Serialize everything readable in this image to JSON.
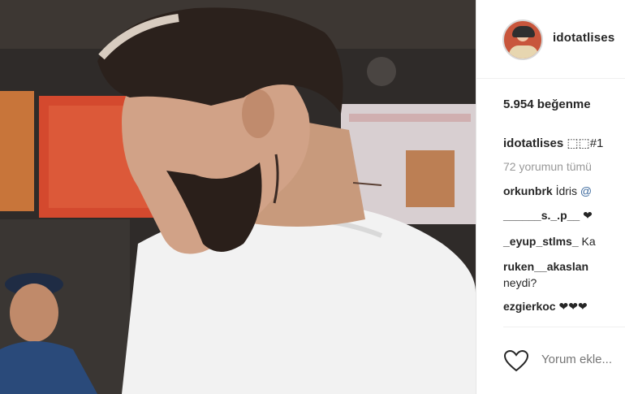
{
  "post": {
    "username": "idotatlises",
    "likes": "5.954 beğenme",
    "caption_user": "idotatlises",
    "caption_text": "⬚⬚#1",
    "view_all_comments": "72 yorumun tümü",
    "comments": [
      {
        "user": "orkunbrk",
        "text": "İdris ",
        "mention": "@"
      },
      {
        "user": "______s._.p__",
        "text": " ❤"
      },
      {
        "user": "_eyup_stlms_",
        "text": " Ka"
      },
      {
        "user": "ruken__akaslan",
        "text": "",
        "text_line2": "neydi?"
      },
      {
        "user": "ezgierkoc",
        "text": " ❤❤❤"
      }
    ],
    "add_comment_placeholder": "Yorum ekle...",
    "icons": [
      "avatar",
      "heart-icon"
    ]
  },
  "colors": {
    "text": "#262626",
    "muted": "#999999",
    "placeholder": "#b5b5b5",
    "mention": "#3d6a9e"
  }
}
